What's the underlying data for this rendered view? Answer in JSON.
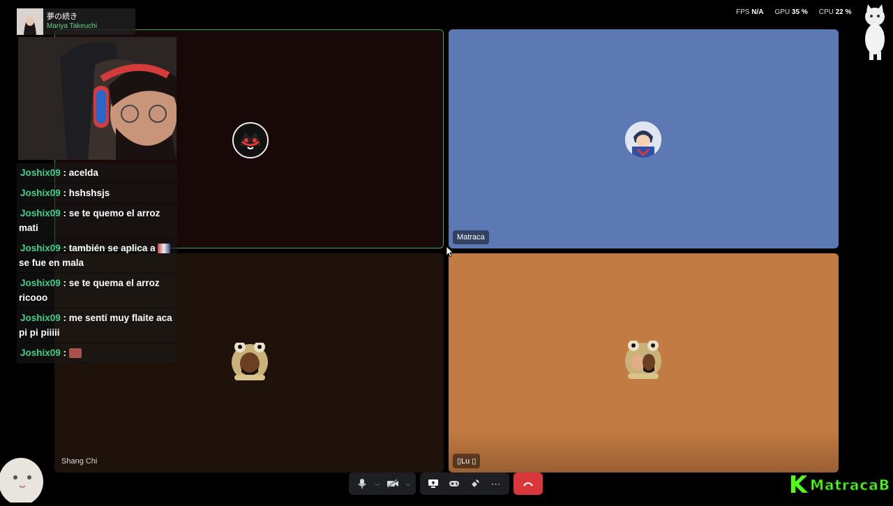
{
  "now_playing": {
    "title": "夢の続き",
    "artist": "Mariya Takeuchi"
  },
  "stats": {
    "fps_label": "FPS",
    "fps_value": "N/A",
    "gpu_label": "GPU",
    "gpu_value": "35 %",
    "cpu_label": "CPU",
    "cpu_value": "22 %"
  },
  "chat": [
    {
      "user": "Joshix09",
      "sep": " : ",
      "msg": "acelda"
    },
    {
      "user": "Joshix09",
      "sep": " : ",
      "msg": "hshshsjs"
    },
    {
      "user": "Joshix09",
      "sep": " : ",
      "msg": "se te quemo el arroz mati"
    },
    {
      "user": "Joshix09",
      "sep": " : ",
      "msg": "también se aplica a",
      "emote": "emote-1",
      "msg2": "se fue en mala"
    },
    {
      "user": "Joshix09",
      "sep": " : ",
      "msg": "se te quema el arroz ricooo"
    },
    {
      "user": "Joshix09",
      "sep": " : ",
      "msg": "me sentí muy flaite aca pi pi piiiii"
    },
    {
      "user": "Joshix09",
      "sep": " : ",
      "msg": "",
      "emote": "emote-2"
    }
  ],
  "tiles": {
    "top_left": {
      "name": "",
      "avatar": "shadow-hedgehog-avatar",
      "bg": "#180808"
    },
    "top_right": {
      "name": "Matraca",
      "avatar": "anime-character-avatar",
      "bg": "#5c79b4"
    },
    "bottom_left": {
      "name": "Shang Chi",
      "avatar": "frog-hat-avatar",
      "bg": "#1e120a"
    },
    "bottom_right": {
      "name": "▯Lu ▯",
      "avatar": "frog-hat-couple-avatar",
      "bg": "#c27b42"
    }
  },
  "controls": {
    "mic_icon": "microphone-icon",
    "camera_icon": "camera-off-icon",
    "screen_icon": "screen-share-icon",
    "activity_icon": "gamepad-icon",
    "soundboard_icon": "soundboard-icon",
    "more_icon": "more-icon",
    "hangup_icon": "hangup-icon"
  },
  "brand": {
    "logo": "K",
    "name": "MatracaB"
  },
  "colors": {
    "speaking_border": "#3ba55c",
    "chat_user": "#3fd18b",
    "hangup": "#da373c",
    "kick_green": "#53fc18"
  }
}
